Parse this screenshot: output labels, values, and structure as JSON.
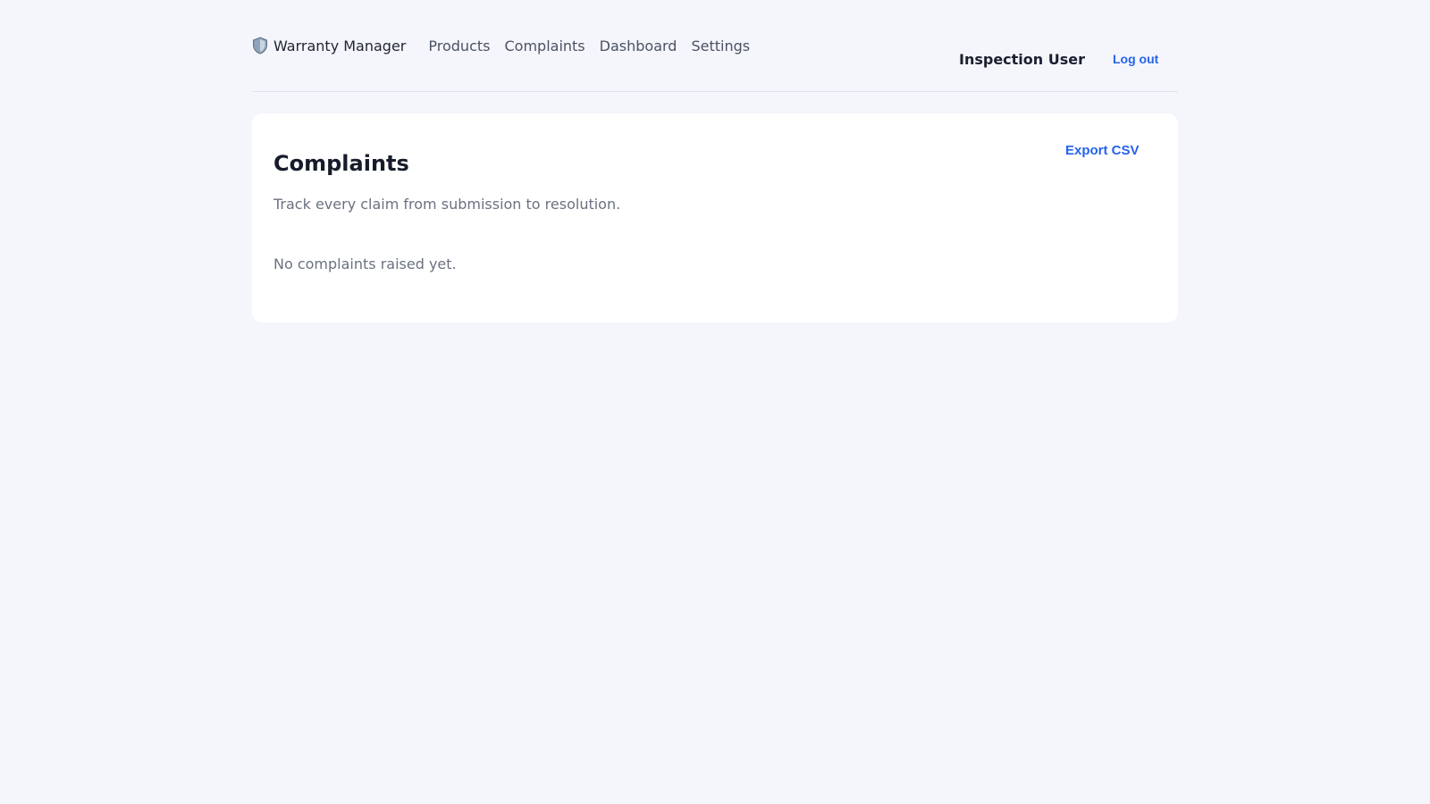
{
  "nav": {
    "brand_icon": "shield-icon",
    "brand_label": "Warranty Manager",
    "links": [
      {
        "label": "Products"
      },
      {
        "label": "Complaints"
      },
      {
        "label": "Dashboard"
      },
      {
        "label": "Settings"
      }
    ],
    "user_name": "Inspection User",
    "logout_label": "Log out"
  },
  "page": {
    "title": "Complaints",
    "subtitle": "Track every claim from submission to resolution.",
    "export_label": "Export CSV",
    "empty_message": "No complaints raised yet."
  },
  "colors": {
    "accent": "#2563eb",
    "background": "#f4f6fb",
    "card": "#ffffff",
    "muted_text": "#6b7180"
  }
}
